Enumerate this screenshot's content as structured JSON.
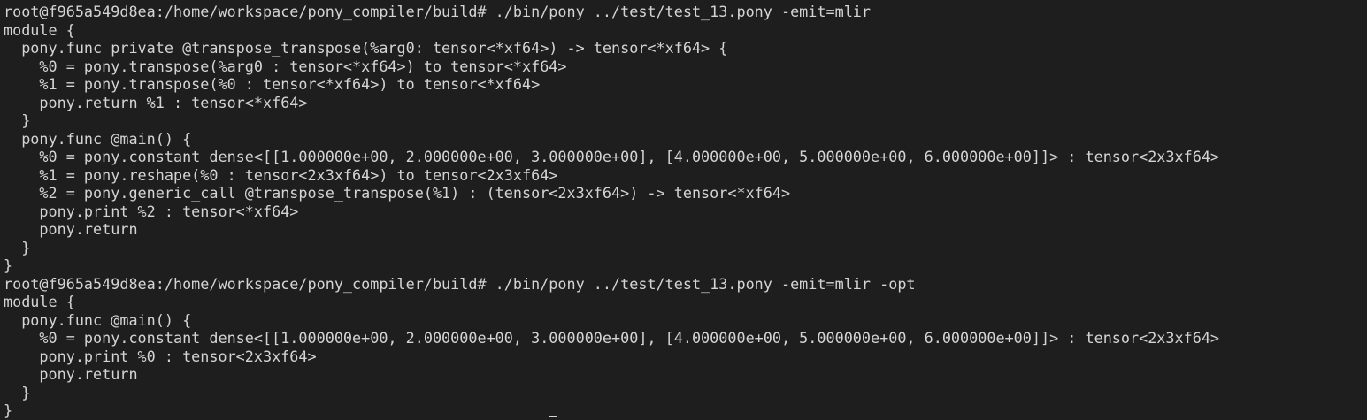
{
  "terminal": {
    "lines": [
      "root@f965a549d8ea:/home/workspace/pony_compiler/build# ./bin/pony ../test/test_13.pony -emit=mlir",
      "module {",
      "  pony.func private @transpose_transpose(%arg0: tensor<*xf64>) -> tensor<*xf64> {",
      "    %0 = pony.transpose(%arg0 : tensor<*xf64>) to tensor<*xf64>",
      "    %1 = pony.transpose(%0 : tensor<*xf64>) to tensor<*xf64>",
      "    pony.return %1 : tensor<*xf64>",
      "  }",
      "  pony.func @main() {",
      "    %0 = pony.constant dense<[[1.000000e+00, 2.000000e+00, 3.000000e+00], [4.000000e+00, 5.000000e+00, 6.000000e+00]]> : tensor<2x3xf64>",
      "    %1 = pony.reshape(%0 : tensor<2x3xf64>) to tensor<2x3xf64>",
      "    %2 = pony.generic_call @transpose_transpose(%1) : (tensor<2x3xf64>) -> tensor<*xf64>",
      "    pony.print %2 : tensor<*xf64>",
      "    pony.return",
      "  }",
      "}",
      "root@f965a549d8ea:/home/workspace/pony_compiler/build# ./bin/pony ../test/test_13.pony -emit=mlir -opt",
      "module {",
      "  pony.func @main() {",
      "    %0 = pony.constant dense<[[1.000000e+00, 2.000000e+00, 3.000000e+00], [4.000000e+00, 5.000000e+00, 6.000000e+00]]> : tensor<2x3xf64>",
      "    pony.print %0 : tensor<2x3xf64>",
      "    pony.return",
      "  }",
      "}"
    ]
  }
}
